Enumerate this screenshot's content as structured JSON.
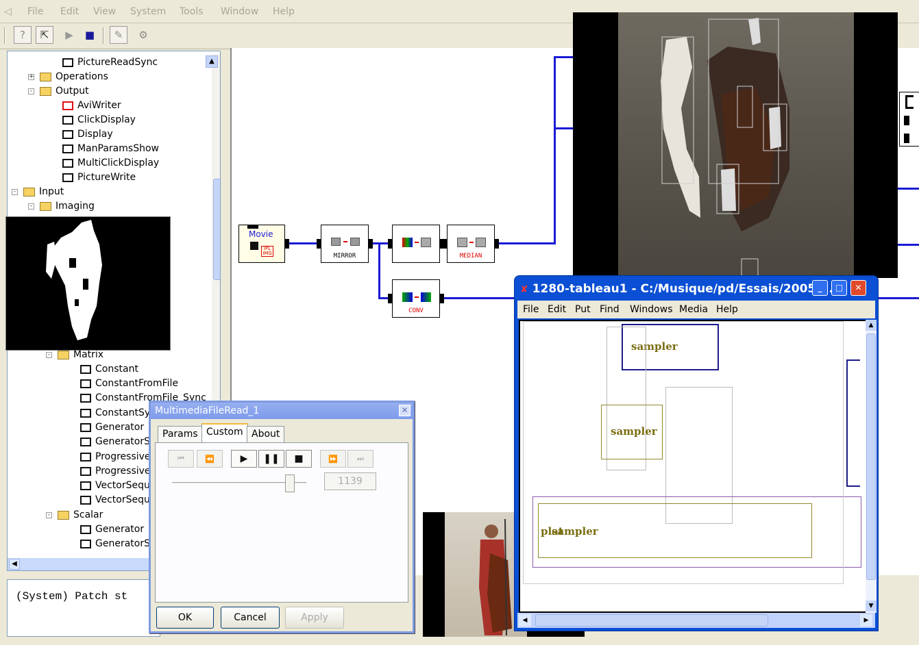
{
  "menubar": {
    "items": [
      {
        "label": "File",
        "key": "F"
      },
      {
        "label": "Edit",
        "key": "E"
      },
      {
        "label": "View",
        "key": "V"
      },
      {
        "label": "System",
        "key": "S"
      },
      {
        "label": "Tools",
        "key": "T"
      },
      {
        "label": "Window",
        "key": "W"
      },
      {
        "label": "Help",
        "key": "H"
      }
    ]
  },
  "toolbar": {
    "icons": [
      "help-icon",
      "help-pointer-icon",
      "play-icon",
      "stop-icon",
      "edit-icon",
      "gear-icon"
    ]
  },
  "tree": {
    "items": [
      {
        "label": "PictureReadSync",
        "kind": "doc"
      },
      {
        "label": "Operations",
        "kind": "folder",
        "toggle": "+"
      },
      {
        "label": "Output",
        "kind": "folder",
        "toggle": "-"
      },
      {
        "label": "AviWriter",
        "kind": "doc-red"
      },
      {
        "label": "ClickDisplay",
        "kind": "doc"
      },
      {
        "label": "Display",
        "kind": "doc"
      },
      {
        "label": "ManParamsShow",
        "kind": "doc"
      },
      {
        "label": "MultiClickDisplay",
        "kind": "doc"
      },
      {
        "label": "PictureWrite",
        "kind": "doc"
      },
      {
        "label": "Input",
        "kind": "folder",
        "toggle": "-"
      },
      {
        "label": "Imaging",
        "kind": "folder",
        "toggle": "-"
      },
      {
        "label": "Matrix",
        "kind": "folder",
        "toggle": "-"
      },
      {
        "label": "Constant",
        "kind": "doc"
      },
      {
        "label": "ConstantFromFile",
        "kind": "doc"
      },
      {
        "label": "ConstantFromFile_Sync",
        "kind": "doc"
      },
      {
        "label": "ConstantSy",
        "kind": "doc"
      },
      {
        "label": "Generator",
        "kind": "doc"
      },
      {
        "label": "GeneratorS",
        "kind": "doc"
      },
      {
        "label": "Progressive",
        "kind": "doc"
      },
      {
        "label": "Progressive",
        "kind": "doc"
      },
      {
        "label": "VectorSequ",
        "kind": "doc"
      },
      {
        "label": "VectorSequ",
        "kind": "doc"
      },
      {
        "label": "Scalar",
        "kind": "folder",
        "toggle": "-"
      },
      {
        "label": "Generator",
        "kind": "doc"
      },
      {
        "label": "GeneratorS",
        "kind": "doc"
      }
    ]
  },
  "patch": {
    "blocks": {
      "movie": {
        "label": "Movie",
        "sub": "IPL IMG"
      },
      "mirror": {
        "label": "MIRROR"
      },
      "colorconv": {
        "label": ""
      },
      "median": {
        "label": "MEDIAN"
      },
      "conv": {
        "label": "CONV"
      }
    }
  },
  "console": {
    "text": "(System)  Patch st"
  },
  "dialog": {
    "title": "MultimediaFileRead_1",
    "tabs": [
      "Params",
      "Custom",
      "About"
    ],
    "active_tab": "Custom",
    "frame_value": "1139",
    "slider_position": 0.88,
    "buttons": {
      "ok": "OK",
      "cancel": "Cancel",
      "apply": "Apply"
    }
  },
  "pd_window": {
    "title": "1280-tableau1  - C:/Musique/pd/Essais/2005/...",
    "menu": [
      "File",
      "Edit",
      "Put",
      "Find",
      "Windows",
      "Media",
      "Help"
    ],
    "objects": [
      "sampler",
      "sampler",
      "sampler",
      "plat"
    ]
  },
  "colors": {
    "wire": "#1a1ad6",
    "xp_title": "#0a4fd4",
    "pd_label": "#7a6d10"
  }
}
